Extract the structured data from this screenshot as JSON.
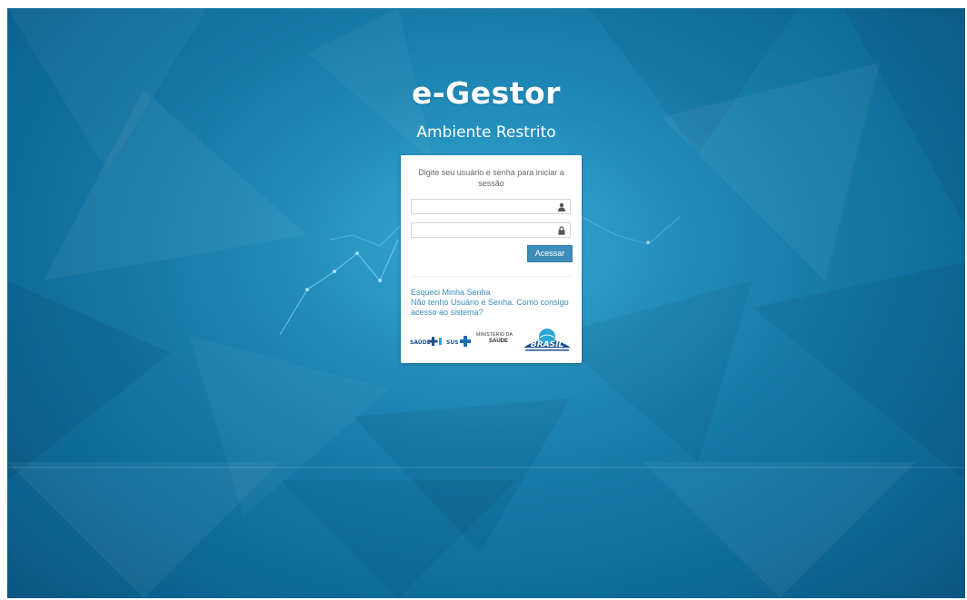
{
  "header": {
    "title": "e-Gestor",
    "subtitle": "Ambiente Restrito"
  },
  "login": {
    "message": "Digite seu usuário e senha para iniciar a sessão",
    "username_value": "",
    "password_value": "",
    "username_icon": "user-icon",
    "password_icon": "lock-icon",
    "submit_label": "Acessar"
  },
  "links": {
    "forgot_password": "Esqueci Minha Senha",
    "no_account": "Não tenho Usuário e Senha. Como consigo acesso ao sistema?"
  },
  "logos": {
    "saude": "SAÚDE",
    "sus": "SUS",
    "ministerio_line1": "MINISTÉRIO DA",
    "ministerio_line2": "SAÚDE",
    "brasil": "BRASIL"
  },
  "colors": {
    "background": "#1a85b6",
    "primary_button": "#3c8dbc",
    "link": "#3c8dbc",
    "text_muted": "#666666"
  }
}
